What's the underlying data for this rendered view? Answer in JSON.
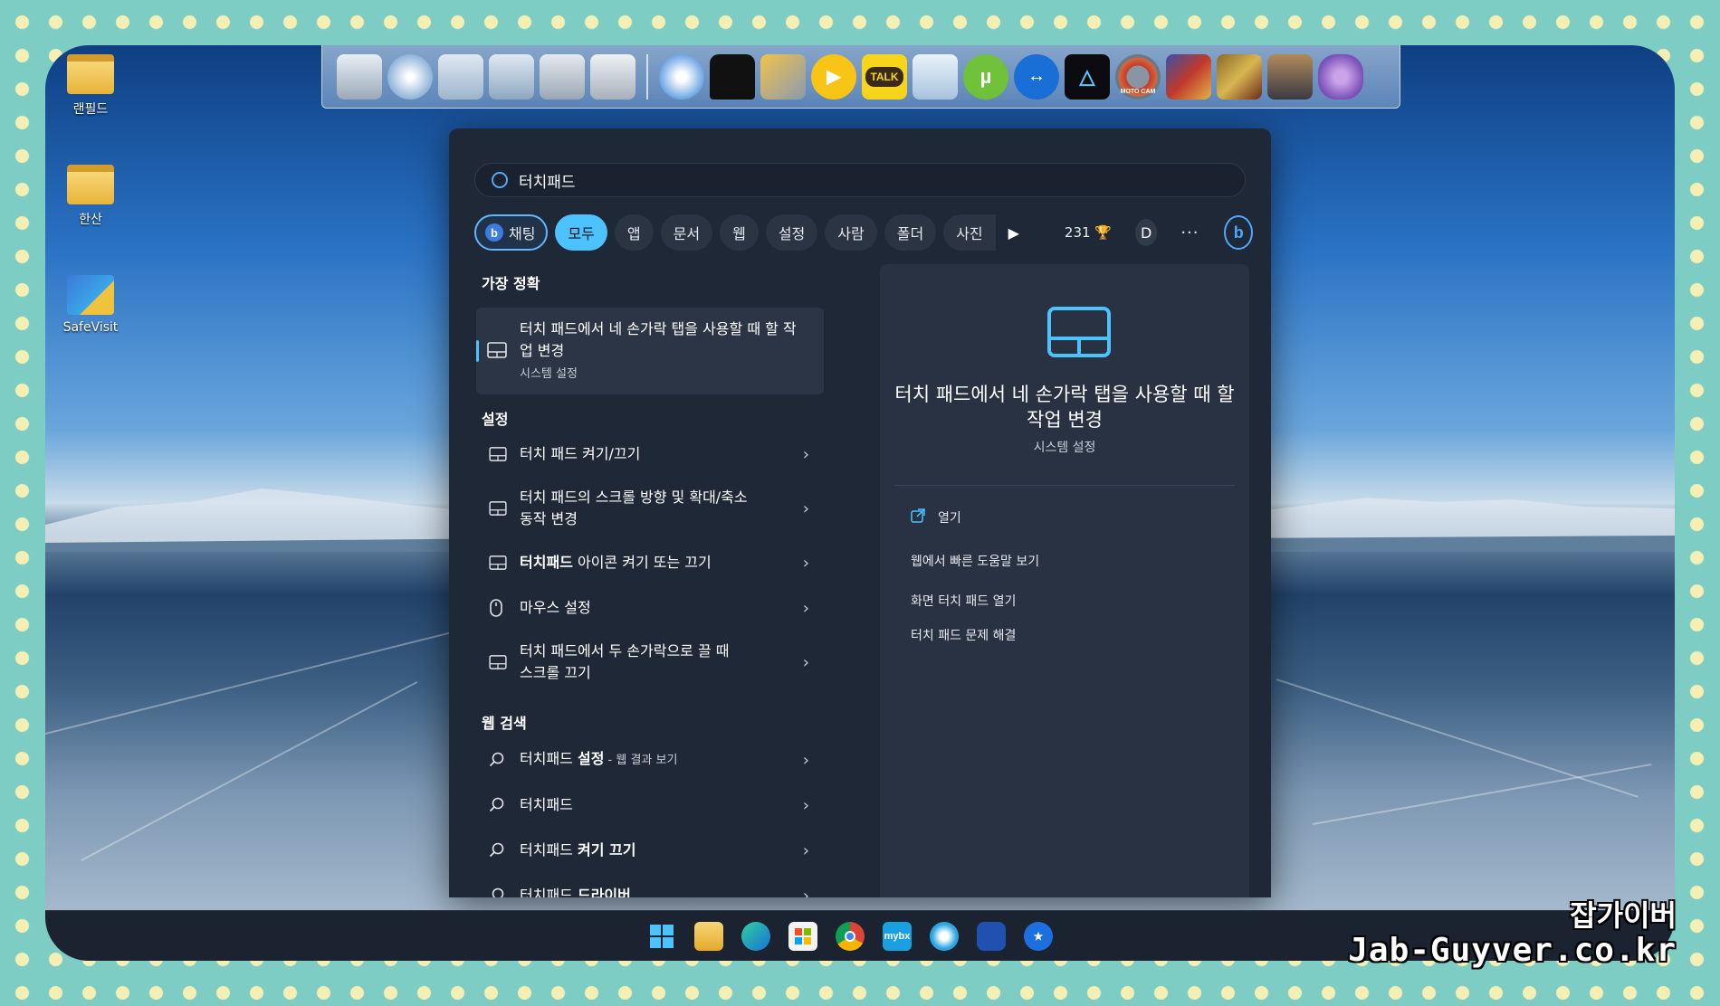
{
  "desktop": {
    "icons": [
      {
        "label": "랜필드",
        "kind": "folder"
      },
      {
        "label": "한산",
        "kind": "folder"
      },
      {
        "label": "SafeVisit",
        "kind": "shortcut"
      }
    ]
  },
  "dock": {
    "icons": [
      "monitor-icon",
      "globe-icon",
      "folder-icon",
      "folder-tree-icon",
      "drive-icon",
      "tools-icon",
      "web-icon",
      "tshirt-icon",
      "tools-wrench-icon",
      "media-player-icon",
      "kakaotalk-icon",
      "recycle-bin-icon",
      "utorrent-icon",
      "teamviewer-icon",
      "prism-icon",
      "moto-cam-icon",
      "game-icon",
      "game-icon-2",
      "figure-icon",
      "tree-icon"
    ],
    "talk_label": "TALK",
    "moto_label": "MOTO CAM"
  },
  "search": {
    "query": "터치패드",
    "filters": {
      "chat": "채팅",
      "all": "모두",
      "apps": "앱",
      "docs": "문서",
      "web": "웹",
      "settings": "설정",
      "people": "사람",
      "folders": "폴더",
      "photos": "사진"
    },
    "points": "231",
    "avatar": "D",
    "more": "···"
  },
  "results": {
    "best_match_title": "가장 정확",
    "best": {
      "title": "터치 패드에서 네 손가락 탭을 사용할 때 할 작업 변경",
      "subtitle": "시스템 설정"
    },
    "settings_title": "설정",
    "settings_items": [
      {
        "text": "터치 패드 켜기/끄기",
        "icon": "touchpad-icon"
      },
      {
        "text": "터치 패드의 스크롤 방향 및 확대/축소 동작 변경",
        "icon": "touchpad-icon"
      },
      {
        "bold": "터치패드",
        "text": " 아이콘 켜기 또는 끄기",
        "icon": "touchpad-icon"
      },
      {
        "text": "마우스 설정",
        "icon": "mouse-icon"
      },
      {
        "text": "터치 패드에서 두 손가락으로 끌 때 스크롤 끄기",
        "icon": "touchpad-icon"
      }
    ],
    "web_title": "웹 검색",
    "web_items": [
      {
        "text": "터치패드 ",
        "bold": "설정",
        "suffix": " - 웹 결과 보기"
      },
      {
        "text": "터치패드",
        "bold": "",
        "suffix": ""
      },
      {
        "text": "터치패드 ",
        "bold": "켜기 끄기",
        "suffix": ""
      },
      {
        "text": "터치패드 ",
        "bold": "드라이버",
        "suffix": ""
      }
    ]
  },
  "preview": {
    "title": "터치 패드에서 네 손가락 탭을 사용할 때 할 작업 변경",
    "subtitle": "시스템 설정",
    "open": "열기",
    "actions": [
      "웹에서 빠른 도움말 보기",
      "화면 터치 패드 열기",
      "터치 패드 문제 해결"
    ]
  },
  "taskbar": {
    "icons": [
      "start-icon",
      "file-explorer-icon",
      "edge-icon",
      "store-icon",
      "chrome-icon",
      "mybox-icon",
      "telegram-icon",
      "safevisit-icon",
      "app-icon"
    ],
    "mybox_label": "mybx"
  },
  "watermark": {
    "korean": "잡가이버",
    "english": "Jab-Guyver.co.kr"
  },
  "colors": {
    "accent": "#4cc2ff",
    "panel": "#1f2837",
    "preview_panel": "#283243",
    "taskbar": "#1b2330"
  }
}
